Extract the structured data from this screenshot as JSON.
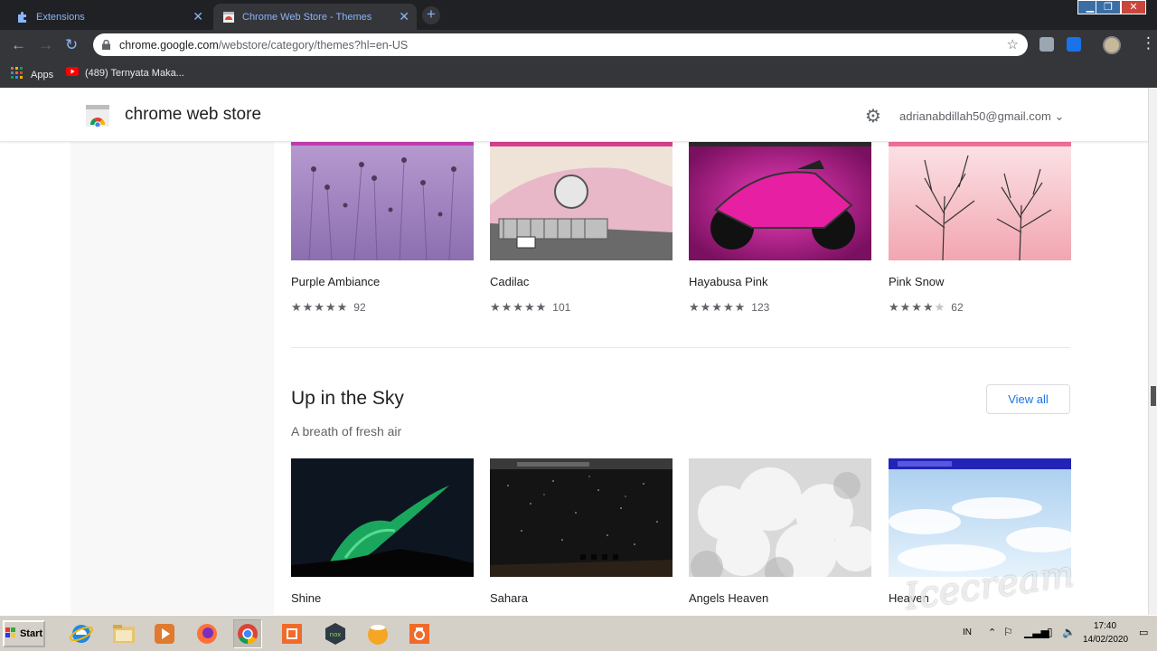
{
  "tabs": [
    {
      "title": "Extensions",
      "icon": "puzzle-icon"
    },
    {
      "title": "Chrome Web Store - Themes",
      "icon": "webstore-icon"
    }
  ],
  "address": {
    "host": "chrome.google.com",
    "path": "/webstore/category/themes?hl=en-US"
  },
  "bookmarks": [
    {
      "label": "Apps",
      "icon": "apps-grid-icon"
    },
    {
      "label": "(489) Ternyata Maka...",
      "icon": "youtube-icon"
    }
  ],
  "header": {
    "brand": "chrome web store",
    "account": "adrianabdillah50@gmail.com"
  },
  "row1": [
    {
      "name": "Purple Ambiance",
      "rating": 4.5,
      "count": "92"
    },
    {
      "name": "Cadilac",
      "rating": 4.5,
      "count": "101"
    },
    {
      "name": "Hayabusa Pink",
      "rating": 4.5,
      "count": "123"
    },
    {
      "name": "Pink Snow",
      "rating": 4,
      "count": "62"
    }
  ],
  "section": {
    "title": "Up in the Sky",
    "subtitle": "A breath of fresh air",
    "view_all": "View all"
  },
  "row2": [
    {
      "name": "Shine"
    },
    {
      "name": "Sahara"
    },
    {
      "name": "Angels Heaven"
    },
    {
      "name": "Heaven"
    }
  ],
  "taskbar": {
    "start": "Start",
    "lang": "IN",
    "time": "17:40",
    "date": "14/02/2020"
  },
  "watermark": "Icecream",
  "colors": {
    "link": "#1a73e8",
    "chrome_dark": "#202124",
    "taskbar": "#d4d0c8"
  }
}
